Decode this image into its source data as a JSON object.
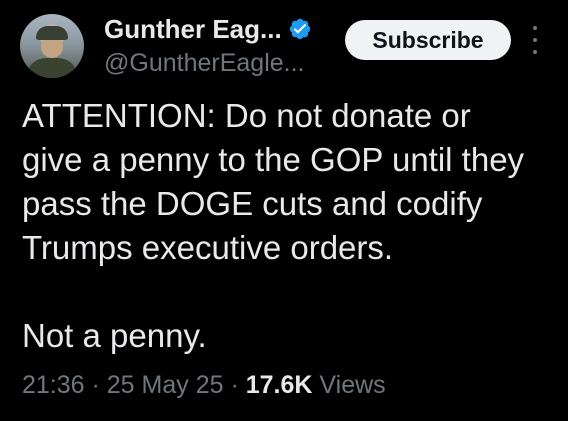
{
  "author": {
    "display_name": "Gunther Eag...",
    "handle": "@GuntherEagle...",
    "verified": true,
    "avatar_icon": "user-avatar"
  },
  "actions": {
    "subscribe_label": "Subscribe",
    "more_icon": "more-vertical-icon"
  },
  "tweet": {
    "text": "ATTENTION:  Do not donate or\ngive a penny to the GOP until they\npass the DOGE cuts and codify\nTrumps executive orders.\n\nNot a penny."
  },
  "meta": {
    "time": "21:36",
    "separator_1": " · ",
    "date": "25 May 25",
    "separator_2": " · ",
    "views_count": "17.6K",
    "views_label": " Views"
  },
  "colors": {
    "background": "#000000",
    "text_primary": "#e7e9ea",
    "text_secondary": "#71767b",
    "verified_blue": "#1d9bf0",
    "button_bg": "#eff3f4"
  }
}
